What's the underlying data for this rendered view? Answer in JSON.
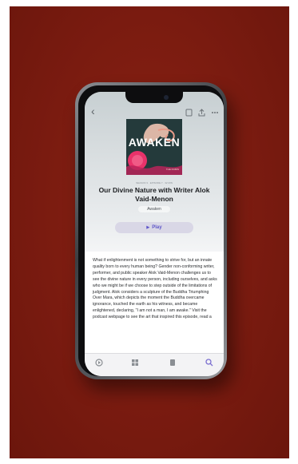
{
  "nav": {
    "back_icon": "chevron-left-icon",
    "save_icon": "bookmark-icon",
    "share_icon": "share-icon",
    "more_icon": "ellipsis-icon"
  },
  "artwork": {
    "title": "AWAKEN",
    "tag": "THE RUBIN"
  },
  "episode": {
    "meta": "SEASON 3 · EPISODE 7 · 32 MIN",
    "title": "Our Divine Nature with Writer Alok Vaid-Menon",
    "show": "Awaken"
  },
  "play": {
    "label": "Play",
    "icon": "play-icon"
  },
  "description": "What if enlightenment is not something to strive for, but an innate quality born to every human being? Gender non-conforming writer, performer, and public speaker Alok Vaid-Menon challenges us to see the divine nature in every person, including ourselves, and asks who we might be if we choose to step outside of the limitations of judgment. Alok considers a sculpture of the Buddha Triumphing Over Mara, which depicts the moment the Buddha overcame ignorance, touched the earth as his witness, and became enlightened, declaring, \"I am not a man, I am awake.\" Visit the podcast webpage to see the art that inspired this episode, read a",
  "tabs": {
    "listen_now": "listen-now-icon",
    "browse": "browse-grid-icon",
    "library": "library-icon",
    "search": "search-icon"
  },
  "colors": {
    "backdrop": "#7d1c10",
    "accent": "#7b6fd0",
    "artwork_bg": "#243a3b",
    "artwork_accent": "#e8326a"
  }
}
